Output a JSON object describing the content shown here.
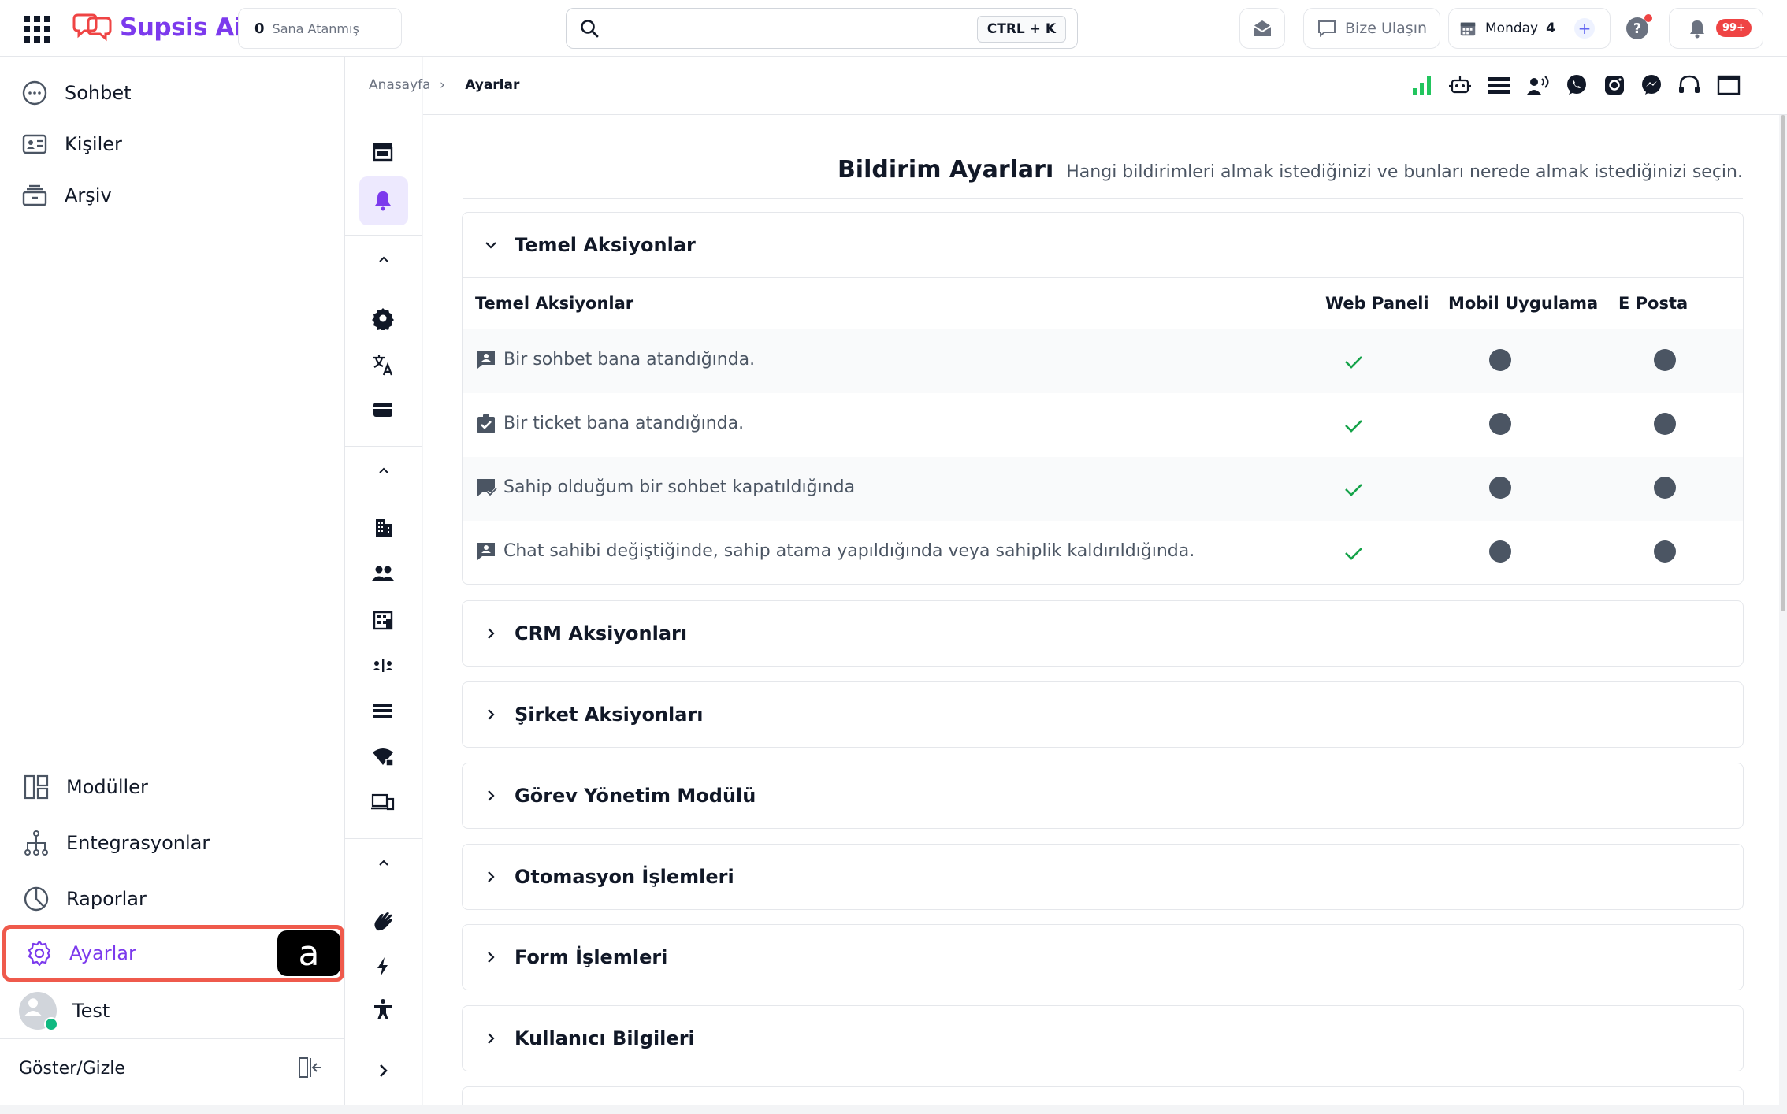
{
  "topbar": {
    "brand": "Supsis Ai",
    "assigned_count": "0",
    "assigned_label": "Sana Atanmış",
    "search_placeholder": "",
    "search_shortcut": "CTRL + K",
    "contact_label": "Bize Ulaşın",
    "calendar_day": "Monday",
    "calendar_count": "4",
    "notification_badge": "99+"
  },
  "sidebar": {
    "top_items": [
      {
        "label": "Sohbet",
        "icon": "chat-bubble-icon"
      },
      {
        "label": "Kişiler",
        "icon": "contact-card-icon"
      },
      {
        "label": "Arşiv",
        "icon": "archive-icon"
      }
    ],
    "bottom_items": [
      {
        "label": "Modüller",
        "icon": "modules-icon"
      },
      {
        "label": "Entegrasyonlar",
        "icon": "integrations-icon"
      },
      {
        "label": "Raporlar",
        "icon": "reports-icon"
      },
      {
        "label": "Ayarlar",
        "icon": "gear-icon",
        "active": true
      },
      {
        "label": "Test",
        "icon": "avatar"
      }
    ],
    "annotation_tag": "a",
    "toggle_label": "Göster/Gizle"
  },
  "breadcrumb": {
    "home": "Anasayfa",
    "separator": "›",
    "current": "Ayarlar"
  },
  "page": {
    "title": "Bildirim Ayarları",
    "subtitle": "Hangi bildirimleri almak istediğinizi ve bunları nerede almak istediğinizi seçin."
  },
  "table": {
    "columns": [
      "Temel Aksiyonlar",
      "Web Paneli",
      "Mobil Uygulama",
      "E Posta"
    ],
    "rows": [
      {
        "text": "Bir sohbet bana atandığında.",
        "icon": "chat-assign-icon",
        "web": true,
        "mobile": false,
        "email": false
      },
      {
        "text": "Bir ticket bana atandığında.",
        "icon": "ticket-check-icon",
        "web": true,
        "mobile": false,
        "email": false
      },
      {
        "text": "Sahip olduğum bir sohbet kapatıldığında",
        "icon": "chat-closed-icon",
        "web": true,
        "mobile": false,
        "email": false
      },
      {
        "text": "Chat sahibi değiştiğinde, sahip atama yapıldığında veya sahiplik kaldırıldığında.",
        "icon": "chat-owner-icon",
        "web": true,
        "mobile": false,
        "email": false
      }
    ]
  },
  "sections": [
    {
      "label": "Temel Aksiyonlar",
      "expanded": true
    },
    {
      "label": "CRM Aksiyonları",
      "expanded": false
    },
    {
      "label": "Şirket Aksiyonları",
      "expanded": false
    },
    {
      "label": "Görev Yönetim Modülü",
      "expanded": false
    },
    {
      "label": "Otomasyon İşlemleri",
      "expanded": false
    },
    {
      "label": "Form İşlemleri",
      "expanded": false
    },
    {
      "label": "Kullanıcı Bilgileri",
      "expanded": false
    }
  ],
  "colors": {
    "brand": "#7c3aed",
    "check": "#16a34a",
    "highlight": "#ef5a4c",
    "badge": "#ef4444"
  }
}
